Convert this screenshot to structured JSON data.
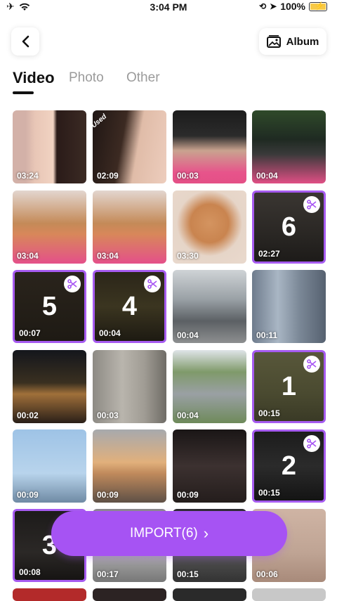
{
  "status": {
    "time": "3:04 PM",
    "battery": "100%"
  },
  "header": {
    "album_label": "Album"
  },
  "tabs": [
    {
      "label": "Video"
    },
    {
      "label": "Photo"
    },
    {
      "label": "Other"
    }
  ],
  "grid": [
    {
      "duration": "03:24"
    },
    {
      "duration": "02:09",
      "badge": "Used"
    },
    {
      "duration": "00:03"
    },
    {
      "duration": "00:04"
    },
    {
      "duration": "03:04"
    },
    {
      "duration": "03:04"
    },
    {
      "duration": "03:30"
    },
    {
      "duration": "02:27",
      "order": "6"
    },
    {
      "duration": "00:07",
      "order": "5"
    },
    {
      "duration": "00:04",
      "order": "4"
    },
    {
      "duration": "00:04"
    },
    {
      "duration": "00:11"
    },
    {
      "duration": "00:02"
    },
    {
      "duration": "00:03"
    },
    {
      "duration": "00:04"
    },
    {
      "duration": "00:15",
      "order": "1"
    },
    {
      "duration": "00:09"
    },
    {
      "duration": "00:09"
    },
    {
      "duration": "00:09"
    },
    {
      "duration": "00:15",
      "order": "2"
    },
    {
      "duration": "00:08",
      "order": "3"
    },
    {
      "duration": "00:17"
    },
    {
      "duration": "00:15"
    },
    {
      "duration": "00:06"
    }
  ],
  "import": {
    "label": "IMPORT(6)",
    "arrow": "›"
  },
  "colors": {
    "accent": "#a653f3",
    "selection_border": "#a65bf0"
  }
}
